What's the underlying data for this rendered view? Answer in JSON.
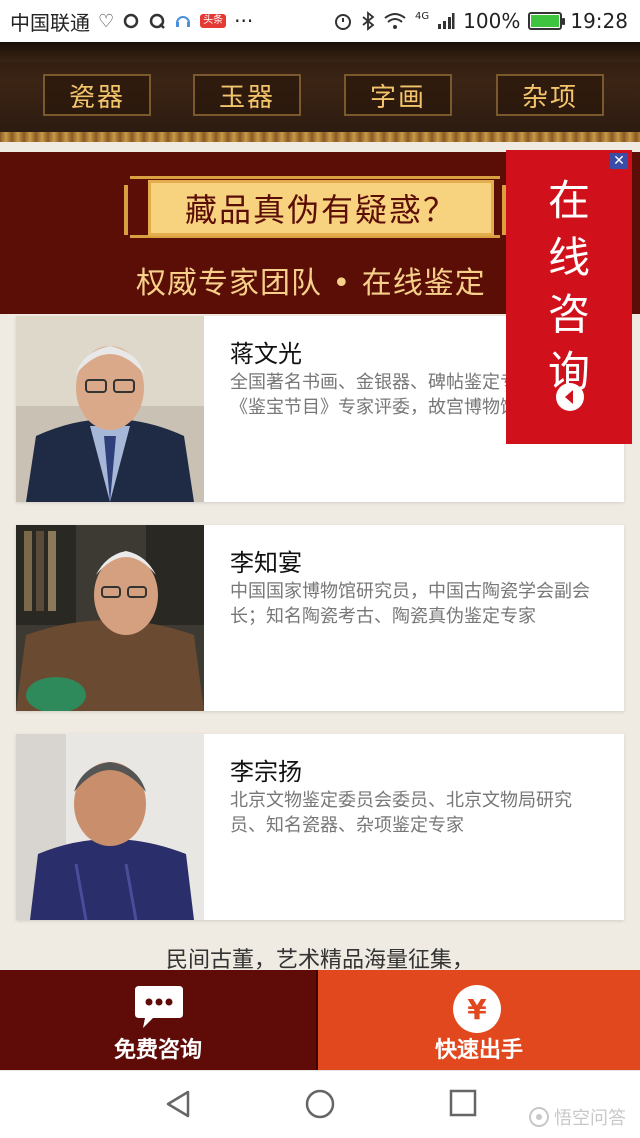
{
  "status_bar": {
    "carrier": "中国联通",
    "badge": "头条",
    "more": "···",
    "network": "4G",
    "battery": "100%",
    "battery_level": 1.0,
    "time": "19:28"
  },
  "categories": [
    "瓷器",
    "玉器",
    "字画",
    "杂项"
  ],
  "banner": {
    "title": "藏品真伪有疑惑？",
    "subtitle": "权威专家团队 • 在线鉴定"
  },
  "experts": [
    {
      "name": "蒋文光",
      "desc": "全国著名书画、金银器、碑帖鉴定专家,CCTV《鉴宝节目》专家评委，故宫博物馆"
    },
    {
      "name": "李知宴",
      "desc": "中国国家博物馆研究员，中国古陶瓷学会副会长；知名陶瓷考古、陶瓷真伪鉴定专家"
    },
    {
      "name": "李宗扬",
      "desc": "北京文物鉴定委员会委员、北京文物局研究员、知名瓷器、杂项鉴定专家"
    }
  ],
  "footnote": "民间古董，艺术精品海量征集，",
  "float_consult": {
    "text": "在线咨询",
    "close": "✕"
  },
  "actions": {
    "free_consult": "免费咨询",
    "quick_sell": "快速出手",
    "sell_symbol": "¥"
  },
  "watermark": "悟空问答",
  "colors": {
    "banner_bg": "#5a0e06",
    "gold": "#f7d27f",
    "float_red": "#d0101a",
    "sell_orange": "#e2481e",
    "consult_dark": "#5f0b07"
  }
}
